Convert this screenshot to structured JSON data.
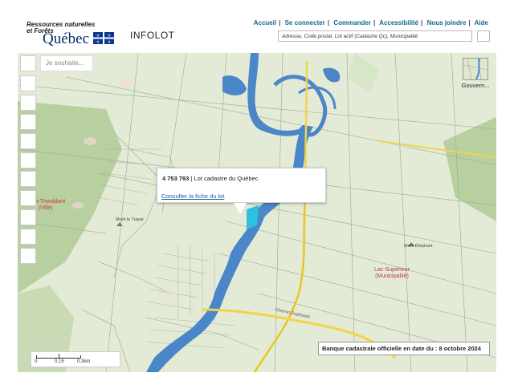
{
  "header": {
    "logo_line1": "Ressources naturelles",
    "logo_line2": "et Forêts",
    "logo_quebec": "Québec",
    "app_title": "INFOLOT"
  },
  "topnav": {
    "items": [
      "Accueil",
      "Se connecter",
      "Commander",
      "Accessibilité",
      "Nous joindre",
      "Aide"
    ]
  },
  "search": {
    "placeholder": "Adresse, Code postal, Lot actif (Cadastre Qc), Municipalité"
  },
  "map": {
    "wish_placeholder": "Je souhaite...",
    "basemap_label": "Gouvern...",
    "popup": {
      "lot_number": "4 753 793",
      "lot_type": " | Lot cadastre du Québec",
      "link": "Consulter la fiche du lot"
    },
    "bank_notice": "Banque cadastrale officielle en date du : 8 octobre 2024",
    "scale": {
      "labels": [
        "0",
        "0.15",
        "0.3km"
      ]
    },
    "place_labels": [
      {
        "name": "Mont-Tremblant",
        "sub": "(Ville)"
      },
      {
        "name": "Lac-Supérieur",
        "sub": "(Municipalité)"
      }
    ],
    "poi_labels": [
      "Mont la Tuque",
      "Mont Éléphant"
    ],
    "road_label": "Chemin Duplessis"
  }
}
